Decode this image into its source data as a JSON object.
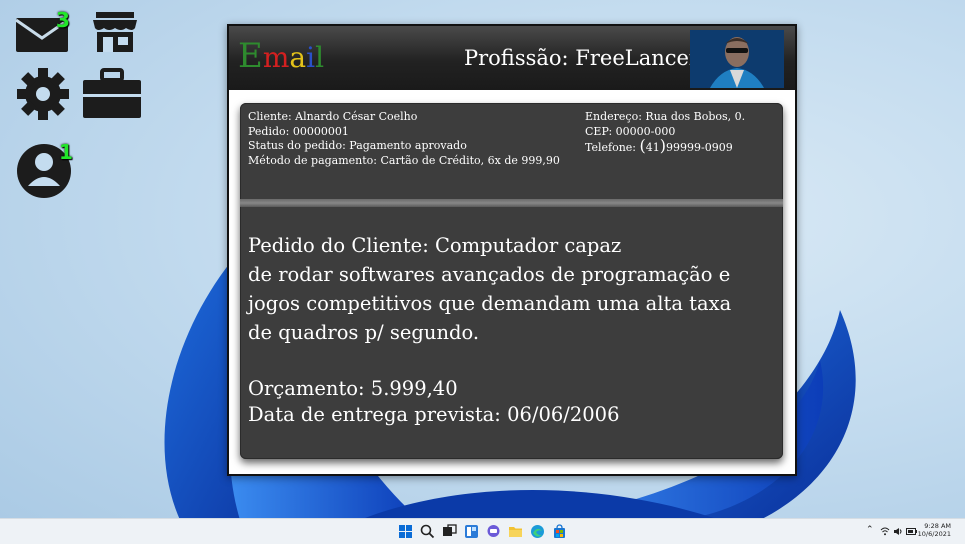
{
  "desktop": {
    "mail_badge": "3",
    "profile_badge": "1"
  },
  "email": {
    "logo_letters": [
      "E",
      "m",
      "a",
      "i",
      "l"
    ],
    "profession": "Profissão: FreeLancer",
    "client": "Cliente: Alnardo César Coelho",
    "order": "Pedido: 00000001",
    "status": "Status do pedido: Pagamento aprovado",
    "payment": "Método de pagamento: Cartão de Crédito, 6x de 999,90",
    "address": "Endereço: Rua dos Bobos, 0.",
    "cep": "CEP: 00000-000",
    "phone_label": "Telefone:",
    "phone_area": "41",
    "phone_number": "99999-0909",
    "request_lines": [
      "Pedido do Cliente: Computador capaz",
      "de rodar softwares avançados de programação e",
      "jogos competitivos que demandam uma alta taxa",
      "de quadros p/ segundo."
    ],
    "budget": "Orçamento: 5.999,40",
    "delivery": "Data de entrega prevista: 06/06/2006"
  },
  "taskbar": {
    "time": "9:28 AM",
    "date": "10/6/2021"
  }
}
